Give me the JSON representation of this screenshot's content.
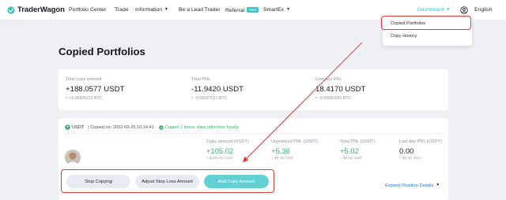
{
  "brand": {
    "name": "TraderWagon",
    "color": "#3bbfbf"
  },
  "nav": {
    "portfolio_center": "Portfolio Center",
    "trade": "Trade",
    "information": "Information",
    "lead_trader": "Be a Lead Trader",
    "referral": "Referral",
    "referral_badge": "New",
    "smartex": "SmartEx",
    "dashboard": "Dashboard",
    "language": "English",
    "user_icon": "user-circle-icon"
  },
  "dropdown": {
    "items": [
      "Copied Portfolios",
      "Copy History"
    ]
  },
  "page": {
    "title": "Copied Portfolios"
  },
  "summary": {
    "total_copy_amount": {
      "label": "Total copy amount",
      "value": "+188.0577 USDT",
      "sub": "≈ +0.00425221 BTC"
    },
    "total_pnl": {
      "label": "Total PNL",
      "value": "-11.9420 USDT",
      "sub": "≈ -0.00027021 BTC"
    },
    "last_day_pnl": {
      "label": "Last day PNL",
      "value": "18.4170 USDT",
      "sub": "≈ -0.00041541 BTC"
    }
  },
  "portfolio": {
    "pair": "USDT",
    "copied_on": "| Copied on: 2022-03-25 10:14:41",
    "copied_note": "Copied 1 times, data refreshes hourly",
    "metrics": {
      "copy_amount": {
        "label": "Copy amount (USDT)",
        "value": "+105.02",
        "sub": "≈ $105.02 USD"
      },
      "unrealized_pnl": {
        "label": "Unrealized PNL (USDT)",
        "value": "+5.36",
        "sub": "≈ $5.36 USD"
      },
      "total_pnl": {
        "label": "Total PNL (USDT)",
        "value": "+5.02",
        "sub": "≈ $5.02 USD"
      },
      "last_day_pnl": {
        "label": "Last day PNL (USDT)",
        "value": "0.00",
        "sub": "≈ $0.00 USD"
      }
    },
    "buttons": {
      "stop_copying": "Stop Copying",
      "adjust_stop_loss": "Adjust Stop Loss Amount",
      "add_copy_amount": "Add Copy Amount"
    },
    "expand": "Expand Position Details"
  },
  "colors": {
    "accent": "#3bbfbf",
    "highlight": "#e03a3a",
    "positive": "#2fb36b",
    "button_grey": "#e7eaf1",
    "button_teal": "#63d1d3"
  }
}
